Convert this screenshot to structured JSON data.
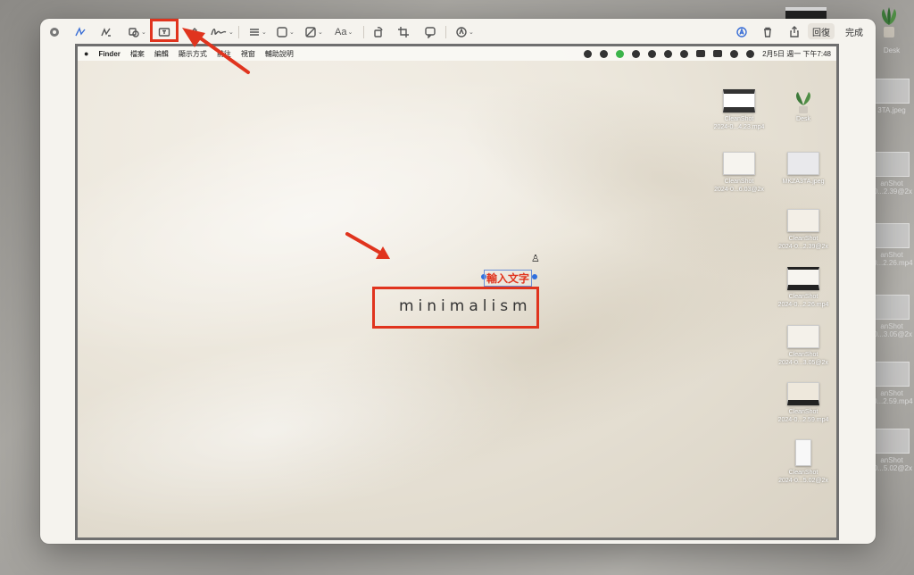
{
  "toolbar": {
    "aa_label": "Aa",
    "revert_label": "回復",
    "done_label": "完成"
  },
  "menubar": {
    "app": "Finder",
    "items": [
      "檔案",
      "編輯",
      "顯示方式",
      "前往",
      "視窗",
      "輔助說明"
    ],
    "clock": "2月5日 週一 下午7:48"
  },
  "desktop_icons": [
    {
      "name": "CleanShot",
      "sub": "2024-0...4.23.mp4"
    },
    {
      "name": "Desk",
      "sub": ""
    },
    {
      "name": "CleanShot",
      "sub": "2024-0...6.03@2x"
    },
    {
      "name": "MKZA3TA.jpeg",
      "sub": ""
    },
    {
      "name": "CleanShot",
      "sub": "2024-0...2.39@2x"
    },
    {
      "name": "CleanShot",
      "sub": "2024-0...2.26.mp4"
    },
    {
      "name": "CleanShot",
      "sub": "2024-0...3.05@2x"
    },
    {
      "name": "CleanShot",
      "sub": "2024-0...2.59.mp4"
    },
    {
      "name": "CleanShot",
      "sub": "2024-0...5.02@2x"
    }
  ],
  "outer_icons": [
    {
      "label": "Desk"
    },
    {
      "label": "3TA.jpeg"
    },
    {
      "label": "anShot\n-0...2.39@2x"
    },
    {
      "label": "anShot\n-0...2.26.mp4"
    },
    {
      "label": "anShot\n-0...3.05@2x"
    },
    {
      "label": "anShot\n-0...2.59.mp4"
    },
    {
      "label": "anShot\n-0...5.02@2x"
    }
  ],
  "canvas": {
    "typed_label": "輸入文字",
    "main_text": "minimalism"
  },
  "colors": {
    "annotation_red": "#e0341e",
    "selection_blue": "#2f6fde"
  }
}
